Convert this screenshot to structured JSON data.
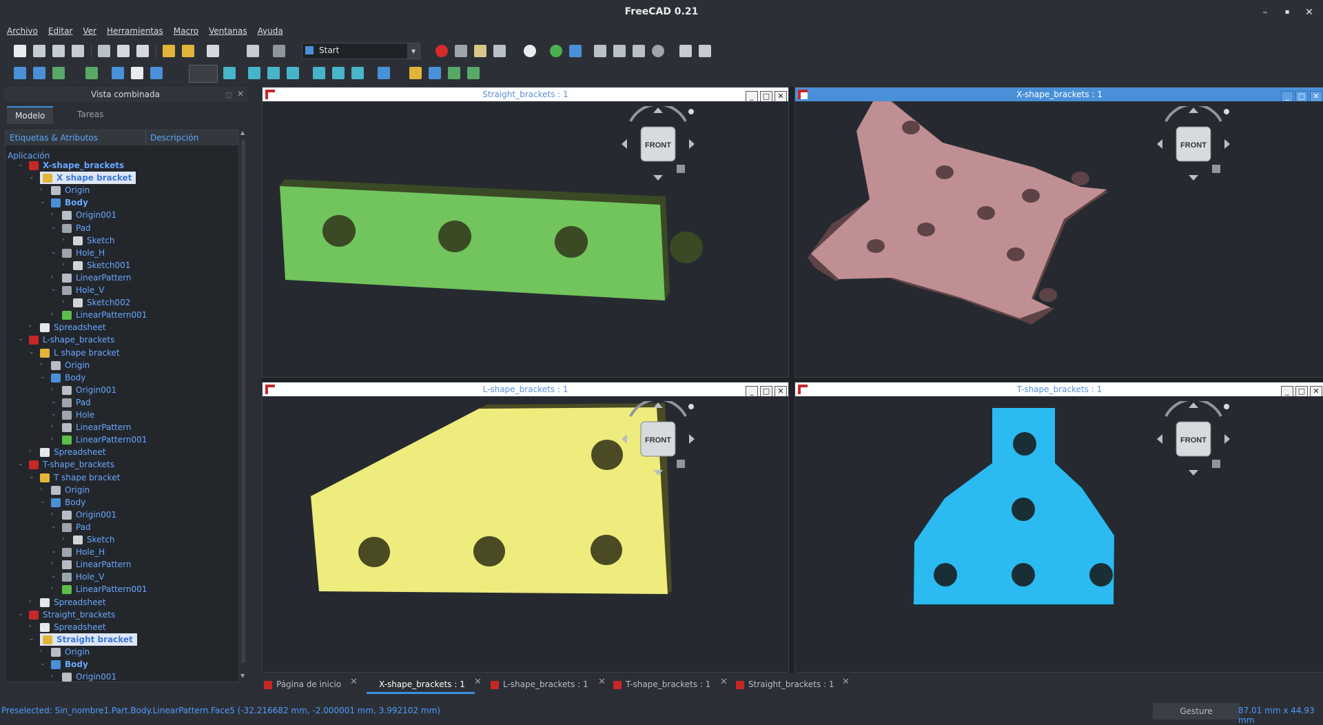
{
  "window": {
    "title": "FreeCAD 0.21",
    "minimize": "–",
    "maximize": "▪",
    "close": "✕"
  },
  "menu": [
    "Archivo",
    "Editar",
    "Ver",
    "Herramientas",
    "Macro",
    "Ventanas",
    "Ayuda"
  ],
  "toolbar": {
    "workbench": "Start",
    "workbench_arrow": "▾"
  },
  "combo": {
    "title": "Vista combinada",
    "tabs": [
      "Modelo",
      "Tareas"
    ],
    "headers": [
      "Etiquetas & Atributos",
      "Descripción"
    ],
    "group": "Aplicación"
  },
  "tree": [
    {
      "label": "X-shape_brackets",
      "level": 0,
      "icon": "doc",
      "bold": true
    },
    {
      "label": "X shape bracket",
      "level": 1,
      "icon": "part",
      "bold": true,
      "selected": true
    },
    {
      "label": "Origin",
      "level": 2,
      "icon": "origin"
    },
    {
      "label": "Body",
      "level": 2,
      "icon": "body",
      "bold": true
    },
    {
      "label": "Origin001",
      "level": 3,
      "icon": "origin"
    },
    {
      "label": "Pad",
      "level": 3,
      "icon": "pad"
    },
    {
      "label": "Sketch",
      "level": 4,
      "icon": "sketch"
    },
    {
      "label": "Hole_H",
      "level": 3,
      "icon": "hole"
    },
    {
      "label": "Sketch001",
      "level": 4,
      "icon": "sketch"
    },
    {
      "label": "LinearPattern",
      "level": 3,
      "icon": "pattern"
    },
    {
      "label": "Hole_V",
      "level": 3,
      "icon": "hole"
    },
    {
      "label": "Sketch002",
      "level": 4,
      "icon": "sketch"
    },
    {
      "label": "LinearPattern001",
      "level": 3,
      "icon": "pattern-green"
    },
    {
      "label": "Spreadsheet",
      "level": 1,
      "icon": "sheet"
    },
    {
      "label": "L-shape_brackets",
      "level": 0,
      "icon": "doc"
    },
    {
      "label": "L shape bracket",
      "level": 1,
      "icon": "part"
    },
    {
      "label": "Origin",
      "level": 2,
      "icon": "origin"
    },
    {
      "label": "Body",
      "level": 2,
      "icon": "body"
    },
    {
      "label": "Origin001",
      "level": 3,
      "icon": "origin"
    },
    {
      "label": "Pad",
      "level": 3,
      "icon": "pad"
    },
    {
      "label": "Hole",
      "level": 3,
      "icon": "hole"
    },
    {
      "label": "LinearPattern",
      "level": 3,
      "icon": "pattern"
    },
    {
      "label": "LinearPattern001",
      "level": 3,
      "icon": "pattern-green"
    },
    {
      "label": "Spreadsheet",
      "level": 1,
      "icon": "sheet"
    },
    {
      "label": "T-shape_brackets",
      "level": 0,
      "icon": "doc"
    },
    {
      "label": "T shape bracket",
      "level": 1,
      "icon": "part"
    },
    {
      "label": "Origin",
      "level": 2,
      "icon": "origin"
    },
    {
      "label": "Body",
      "level": 2,
      "icon": "body"
    },
    {
      "label": "Origin001",
      "level": 3,
      "icon": "origin"
    },
    {
      "label": "Pad",
      "level": 3,
      "icon": "pad"
    },
    {
      "label": "Sketch",
      "level": 4,
      "icon": "sketch"
    },
    {
      "label": "Hole_H",
      "level": 3,
      "icon": "hole"
    },
    {
      "label": "LinearPattern",
      "level": 3,
      "icon": "pattern"
    },
    {
      "label": "Hole_V",
      "level": 3,
      "icon": "hole"
    },
    {
      "label": "LinearPattern001",
      "level": 3,
      "icon": "pattern-green"
    },
    {
      "label": "Spreadsheet",
      "level": 1,
      "icon": "sheet"
    },
    {
      "label": "Straight_brackets",
      "level": 0,
      "icon": "doc"
    },
    {
      "label": "Spreadsheet",
      "level": 1,
      "icon": "sheet"
    },
    {
      "label": "Straight bracket",
      "level": 1,
      "icon": "part",
      "bold": true,
      "selected": true
    },
    {
      "label": "Origin",
      "level": 2,
      "icon": "origin"
    },
    {
      "label": "Body",
      "level": 2,
      "icon": "body",
      "bold": true
    },
    {
      "label": "Origin001",
      "level": 3,
      "icon": "origin"
    }
  ],
  "views": {
    "straight": {
      "title": "Straight_brackets : 1",
      "color": "#72c45c"
    },
    "xshape": {
      "title": "X-shape_brackets : 1",
      "color": "#c08f94"
    },
    "lshape": {
      "title": "L-shape_brackets : 1",
      "color": "#eeec7c"
    },
    "tshape": {
      "title": "T-shape_brackets : 1",
      "color": "#2bbbf1"
    },
    "cube_label": "FRONT"
  },
  "doc_tabs": [
    "Página de inicio",
    "X-shape_brackets : 1",
    "L-shape_brackets : 1",
    "T-shape_brackets : 1",
    "Straight_brackets : 1"
  ],
  "status": {
    "message": "Preselected: Sin_nombre1.Part.Body.LinearPattern.Face5 (-32.216682 mm, -2.000001 mm, 3.992102 mm)",
    "nav_style": "Gesture",
    "dimensions": "87.01 mm x 44.93 mm"
  }
}
